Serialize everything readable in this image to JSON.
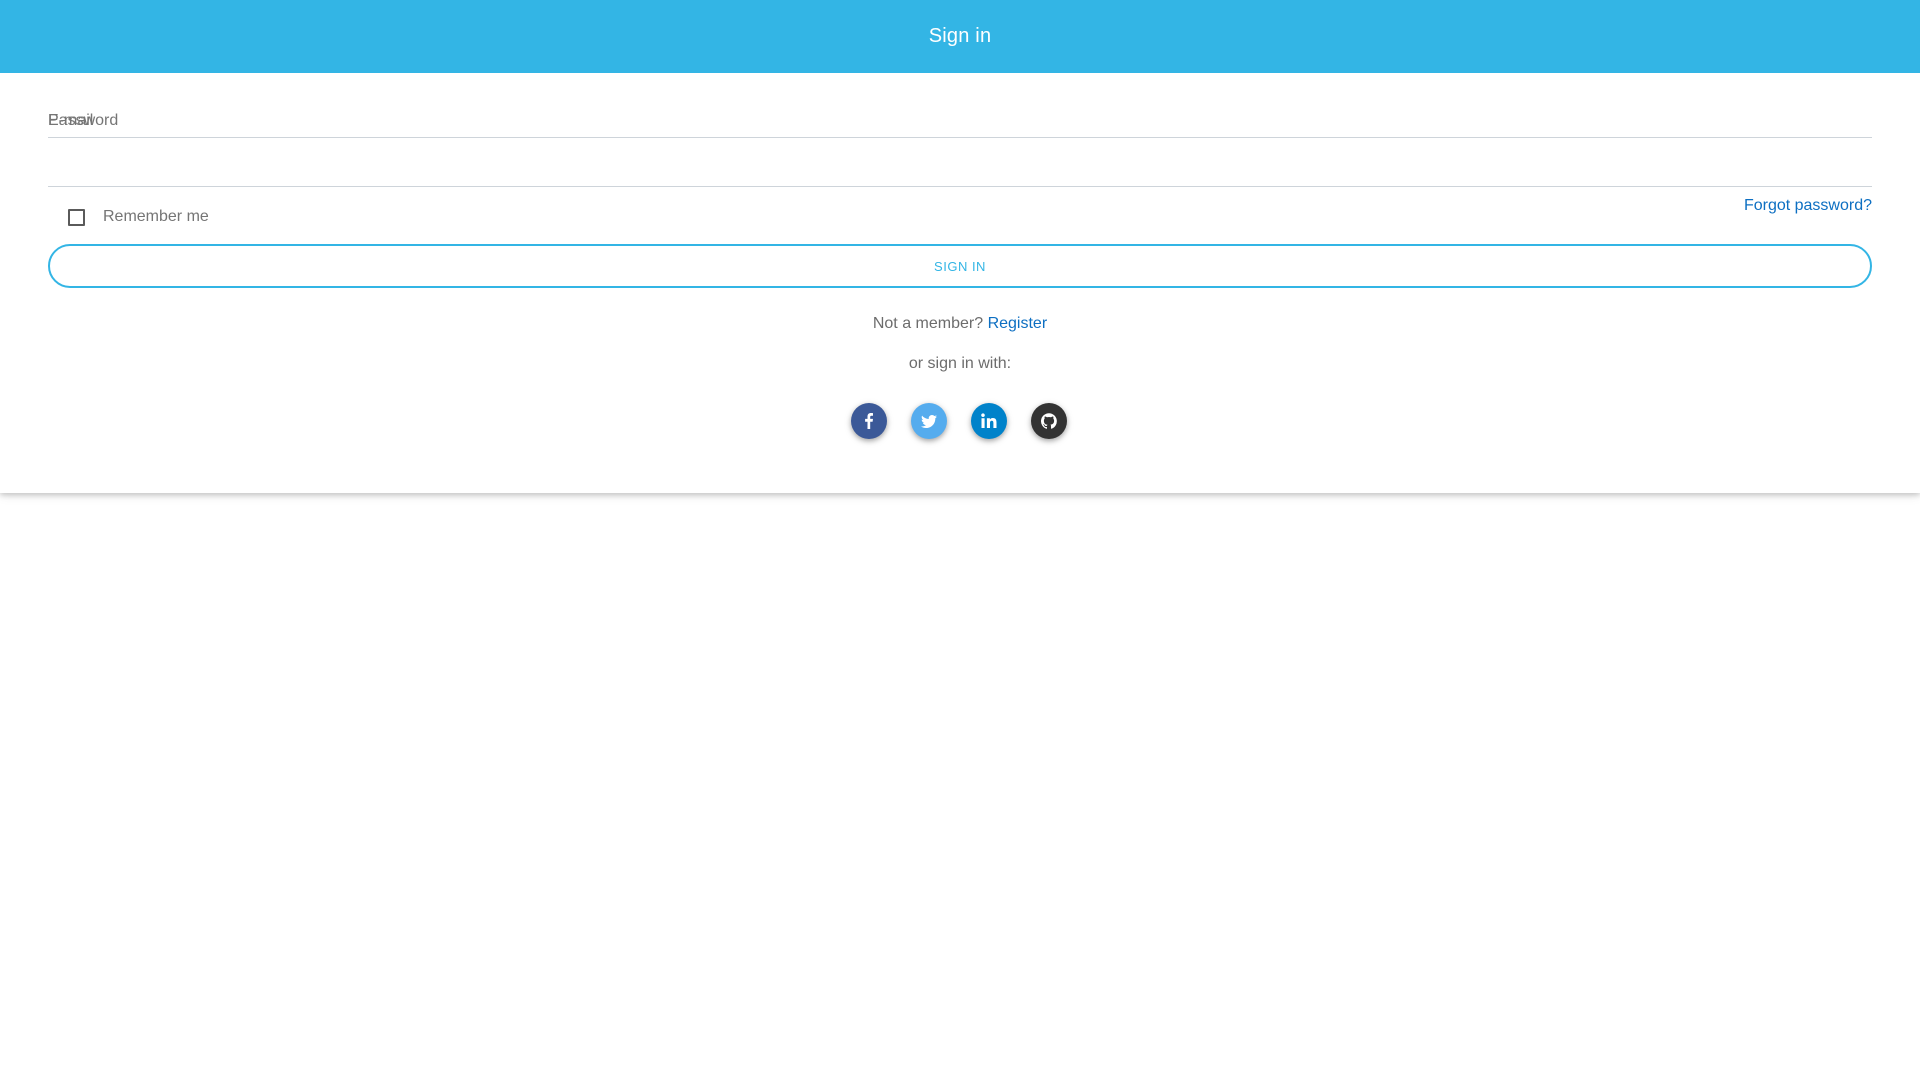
{
  "header": {
    "title": "Sign in"
  },
  "form": {
    "email": {
      "label": "E-mail",
      "value": ""
    },
    "password": {
      "label": "Password",
      "value": ""
    },
    "remember_label": "Remember me",
    "remember_checked": false,
    "forgot_label": "Forgot password?",
    "submit_label": "SIGN IN",
    "not_member_text": "Not a member?",
    "register_label": "Register",
    "or_text": "or sign in with:"
  },
  "socials": [
    {
      "icon": "facebook-icon",
      "color": "#3b5998"
    },
    {
      "icon": "twitter-icon",
      "color": "#55acee"
    },
    {
      "icon": "linkedin-icon",
      "color": "#0082ca"
    },
    {
      "icon": "github-icon",
      "color": "#333333"
    }
  ],
  "colors": {
    "accent": "#33b5e5",
    "link": "#0d6fc2"
  }
}
